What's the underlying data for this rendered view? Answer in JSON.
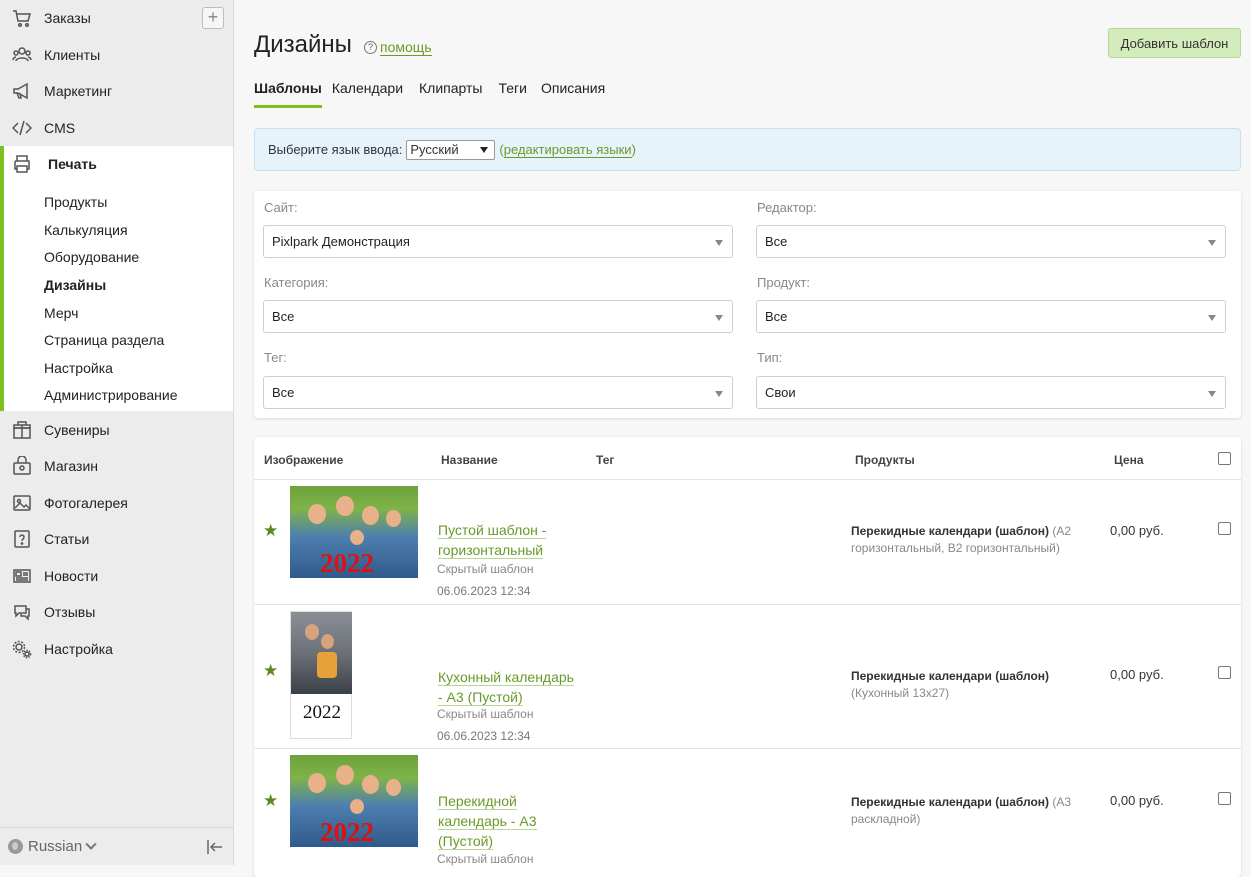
{
  "sidebar": {
    "items": [
      {
        "label": "Заказы",
        "icon": "cart-icon"
      },
      {
        "label": "Клиенты",
        "icon": "users-icon"
      },
      {
        "label": "Маркетинг",
        "icon": "megaphone-icon"
      },
      {
        "label": "CMS",
        "icon": "code-icon"
      },
      {
        "label": "Печать",
        "icon": "printer-icon"
      },
      {
        "label": "Сувениры",
        "icon": "gift-box-icon"
      },
      {
        "label": "Магазин",
        "icon": "shop-bag-icon"
      },
      {
        "label": "Фотогалерея",
        "icon": "image-icon"
      },
      {
        "label": "Статьи",
        "icon": "question-doc-icon"
      },
      {
        "label": "Новости",
        "icon": "newspaper-icon"
      },
      {
        "label": "Отзывы",
        "icon": "chat-icon"
      },
      {
        "label": "Настройка",
        "icon": "gears-icon"
      }
    ],
    "sub_items": [
      "Продукты",
      "Калькуляция",
      "Оборудование",
      "Дизайны",
      "Мерч",
      "Страница раздела",
      "Настройка",
      "Администрирование"
    ],
    "add_label": "+",
    "footer": {
      "language": "Russian"
    }
  },
  "header": {
    "title": "Дизайны",
    "help_icon": "?",
    "help": "помощь",
    "add_button": "Добавить шаблон"
  },
  "tabs": [
    "Шаблоны",
    "Календари",
    "Клипарты",
    "Теги",
    "Описания"
  ],
  "lang_bar": {
    "label": "Выберите язык ввода:",
    "value": "Русский",
    "paren_open": "(",
    "edit_link": "редактировать языки",
    "paren_close": ")"
  },
  "filters": {
    "site": {
      "label": "Сайт:",
      "value": "Pixlpark Демонстрация"
    },
    "editor": {
      "label": "Редактор:",
      "value": "Все"
    },
    "category": {
      "label": "Категория:",
      "value": "Все"
    },
    "product": {
      "label": "Продукт:",
      "value": "Все"
    },
    "tag": {
      "label": "Тег:",
      "value": "Все"
    },
    "type": {
      "label": "Тип:",
      "value": "Свои"
    }
  },
  "table": {
    "columns": {
      "image": "Изображение",
      "name": "Название",
      "tag": "Тег",
      "products": "Продукты",
      "price": "Цена"
    },
    "rows": [
      {
        "name": "Пустой шаблон - горизонтальный",
        "status": "Скрытый шаблон",
        "date": "06.06.2023 12:34",
        "product": "Перекидные календари (шаблон)",
        "product_detail": "(A2 горизонтальный, B2 горизонтальный)",
        "price": "0,00 руб.",
        "image_year": "2022"
      },
      {
        "name": "Кухонный календарь - A3 (Пустой)",
        "status": "Скрытый шаблон",
        "date": "06.06.2023 12:34",
        "product": "Перекидные календари (шаблон)",
        "product_detail": "(Кухонный 13x27)",
        "price": "0,00 руб.",
        "image_year": "2022"
      },
      {
        "name": "Перекидной календарь - A3 (Пустой)",
        "status": "Скрытый шаблон",
        "date": "",
        "product": "Перекидные календари (шаблон)",
        "product_detail": "(A3 раскладной)",
        "price": "0,00 руб.",
        "image_year": "2022"
      }
    ]
  },
  "colors": {
    "accent": "#7ec11f",
    "link": "#6a9a2a",
    "add_button_bg": "#d4ecbc",
    "lang_bar_bg": "#e6f3fb"
  }
}
